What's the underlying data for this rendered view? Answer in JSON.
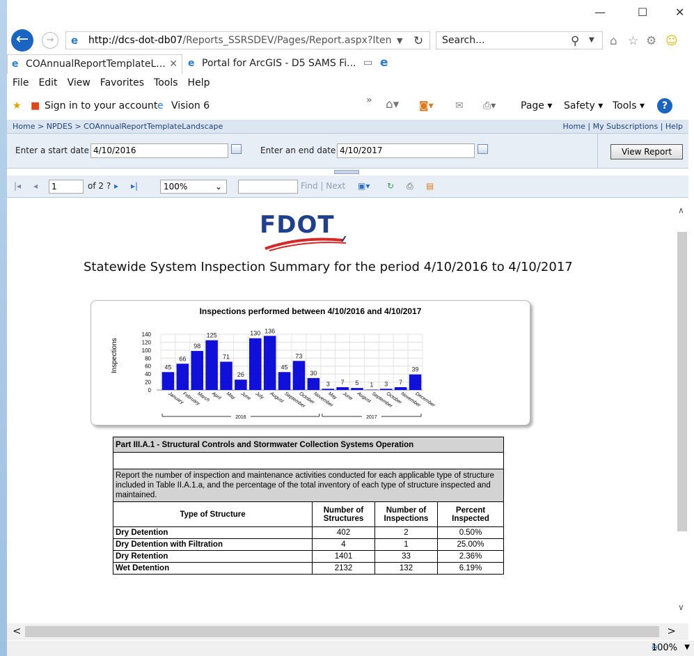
{
  "browser": {
    "url_host": "http://dcs-dot-db07",
    "url_path": "/Reports_SSRSDEV/Pages/Report.aspx?Iten",
    "search_placeholder": "Search...",
    "tabs": [
      {
        "label": "COAnnualReportTemplateL..."
      },
      {
        "label": "Portal for ArcGIS - D5 SAMS Fi..."
      }
    ],
    "menu": [
      "File",
      "Edit",
      "View",
      "Favorites",
      "Tools",
      "Help"
    ],
    "favorites": {
      "signin": "Sign in to your account",
      "vision": "Vision 6"
    },
    "command_bar": {
      "page": "Page",
      "safety": "Safety",
      "tools": "Tools"
    },
    "status_zoom": "100%"
  },
  "report_viewer": {
    "breadcrumbs": "Home > NPDES > COAnnualReportTemplateLandscape",
    "top_links": "Home | My Subscriptions | Help",
    "start_label": "Enter a start date",
    "start_value": "4/10/2016",
    "end_label": "Enter an end date",
    "end_value": "4/10/2017",
    "view_report": "View Report",
    "page_number": "1",
    "page_of": "of 2 ?",
    "zoom": "100%",
    "find": "Find",
    "next": "Next"
  },
  "report": {
    "logo_text": "FDOT",
    "title": "Statewide System Inspection Summary for the period 4/10/2016 to 4/10/2017",
    "table": {
      "header": "Part III.A.1 - Structural Controls and Stormwater Collection Systems Operation",
      "description": "Report the number of inspection and maintenance activities conducted for each applicable type of structure included in Table II.A.1.a, and the percentage of the total inventory of each type of structure inspected and maintained.",
      "columns": [
        "Type of Structure",
        "Number of Structures",
        "Number of Inspections",
        "Percent Inspected"
      ],
      "rows": [
        [
          "Dry Detention",
          "402",
          "2",
          "0.50%"
        ],
        [
          "Dry Detention with Filtration",
          "4",
          "1",
          "25.00%"
        ],
        [
          "Dry Retention",
          "1401",
          "33",
          "2.36%"
        ],
        [
          "Wet Detention",
          "2132",
          "132",
          "6.19%"
        ]
      ]
    }
  },
  "chart_data": {
    "type": "bar",
    "title": "Inspections performed between 4/10/2016 and 4/10/2017",
    "ylabel": "Inspections",
    "ylim": [
      0,
      140
    ],
    "yticks": [
      0,
      20,
      40,
      60,
      80,
      100,
      120,
      140
    ],
    "bar_color": "#1010d8",
    "categories": [
      "January",
      "February",
      "March",
      "April",
      "May",
      "June",
      "July",
      "August",
      "September",
      "October",
      "November",
      "May",
      "June",
      "August",
      "September",
      "October",
      "November",
      "December"
    ],
    "values": [
      45,
      66,
      98,
      125,
      71,
      26,
      130,
      136,
      45,
      73,
      30,
      3,
      7,
      5,
      1,
      3,
      7,
      39
    ],
    "data_labels": [
      "45",
      "66",
      "98",
      "125",
      "71",
      "26",
      "130",
      "136",
      "45",
      "73",
      "30",
      "3",
      "7",
      "5",
      "1",
      "3",
      "7",
      "39"
    ],
    "groups": [
      {
        "name": "2016",
        "start": 0,
        "end": 10
      },
      {
        "name": "2017",
        "start": 11,
        "end": 17
      }
    ]
  }
}
